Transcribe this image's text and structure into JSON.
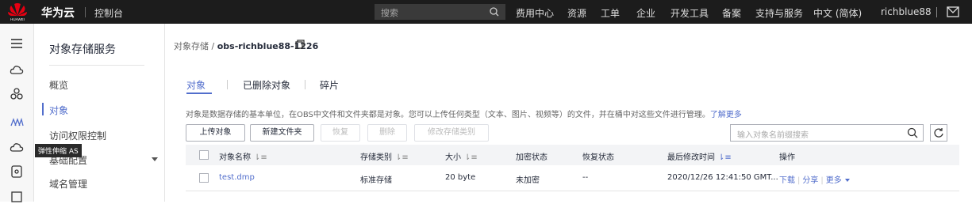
{
  "topbar": {
    "brand": "华为云",
    "logo_text": "HUAWEI",
    "console": "控制台",
    "search_placeholder": "搜索",
    "nav": [
      "费用中心",
      "资源",
      "工单",
      "企业",
      "开发工具",
      "备案",
      "支持与服务",
      "中文 (简体)",
      "richblue88"
    ]
  },
  "rail": {
    "tooltip": "弹性伸缩 AS"
  },
  "sidebar": {
    "title": "对象存储服务",
    "items": [
      "概览",
      "对象",
      "访问权限控制",
      "基础配置",
      "域名管理"
    ]
  },
  "breadcrumb": {
    "root": "对象存储",
    "sep": "/",
    "bucket": "obs-richblue88-1226"
  },
  "tabs": [
    "对象",
    "已删除对象",
    "碎片"
  ],
  "description": "对象是数据存储的基本单位，在OBS中文件和文件夹都是对象。您可以上传任何类型（文本、图片、视频等）的文件，并在桶中对这些文件进行管理。",
  "learn_more": "了解更多",
  "toolbar": {
    "upload": "上传对象",
    "new_folder": "新建文件夹",
    "restore": "恢复",
    "delete": "删除",
    "change_class": "修改存储类别",
    "filter_placeholder": "输入对象名前缀搜索"
  },
  "table": {
    "headers": [
      "对象名称",
      "存储类别",
      "大小",
      "加密状态",
      "恢复状态",
      "最后修改时间",
      "操作"
    ],
    "rows": [
      {
        "name": "test.dmp",
        "class": "标准存储",
        "size": "20 byte",
        "encryption": "未加密",
        "restore": "--",
        "modified": "2020/12/26 12:41:50 GMT...",
        "actions": [
          "下载",
          "分享",
          "更多"
        ]
      }
    ]
  },
  "colors": {
    "accent": "#526ecc",
    "topbar": "#1c1c1c"
  }
}
